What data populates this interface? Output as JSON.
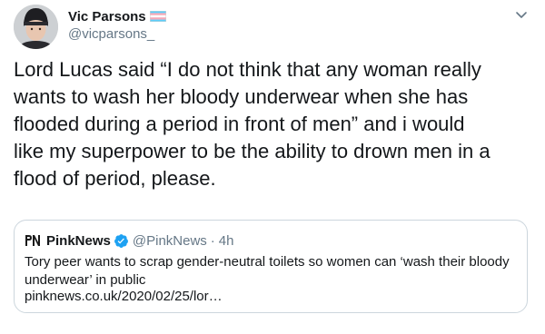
{
  "tweet": {
    "author": {
      "display_name": "Vic Parsons",
      "handle": "@vicparsons_",
      "flag_icon": "trans-flag-icon",
      "flag_colors": [
        "#5BCEFA",
        "#F5A9B8",
        "#FFFFFF",
        "#F5A9B8",
        "#5BCEFA"
      ]
    },
    "menu_icon": "chevron-down-icon",
    "text_lines": [
      "Lord Lucas said “I do not think that any woman really",
      "wants to wash her bloody underwear when she has",
      "flooded during a period in front of men” and i would",
      "like my superpower to be the ability to drown men in a",
      "flood of period, please."
    ]
  },
  "quote": {
    "logo_icon": "pinknews-logo-icon",
    "display_name": "PinkNews",
    "verified_icon": "verified-badge-icon",
    "verified_color": "#1DA1F2",
    "handle": "@PinkNews",
    "separator": "·",
    "time": "4h",
    "text_lines": [
      "Tory peer wants to scrap gender-neutral toilets so women can ‘wash their bloody",
      "underwear’ in public"
    ],
    "link": "pinknews.co.uk/2020/02/25/lor…"
  },
  "colors": {
    "text_primary": "#14171A",
    "text_secondary": "#657786",
    "border": "#CCD6DD"
  }
}
